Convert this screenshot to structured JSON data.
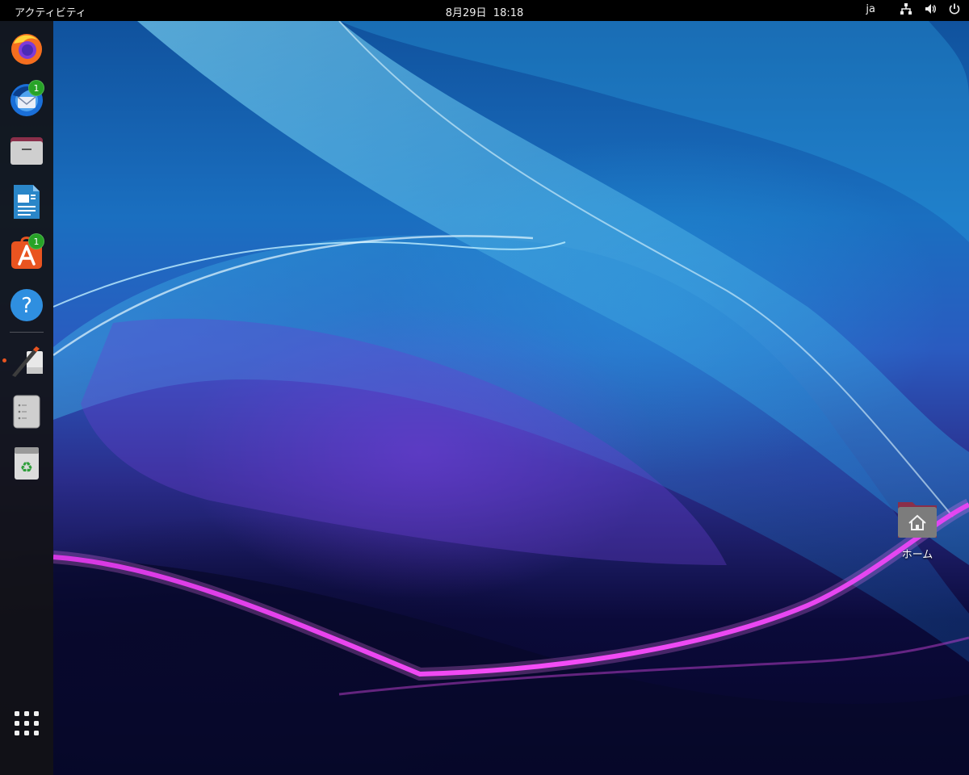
{
  "topbar": {
    "activities_label": "アクティビティ",
    "clock": "8月29日  18:18",
    "language": "ja",
    "tray_icons": [
      "network-icon",
      "volume-icon",
      "power-icon"
    ]
  },
  "dock": {
    "apps": [
      {
        "name": "Firefox",
        "icon": "firefox-icon"
      },
      {
        "name": "Thunderbird",
        "icon": "thunderbird-icon",
        "badge": "1"
      },
      {
        "name": "Files",
        "icon": "files-icon"
      },
      {
        "name": "LibreOffice Writer",
        "icon": "writer-icon"
      },
      {
        "name": "Ubuntu Software",
        "icon": "software-icon",
        "badge": "1"
      },
      {
        "name": "Help",
        "icon": "help-icon"
      },
      {
        "name": "Text Editor",
        "icon": "text-editor-icon",
        "running": true
      },
      {
        "name": "Disk Drive",
        "icon": "drive-icon"
      },
      {
        "name": "Trash",
        "icon": "trash-icon"
      }
    ],
    "show_apps_icon": "app-grid-icon"
  },
  "desktop": {
    "home_label": "ホーム"
  },
  "colors": {
    "topbar_bg": "#000000",
    "dock_bg": "#121216",
    "badge_green": "#27a327",
    "ubuntu_orange": "#e95420"
  }
}
